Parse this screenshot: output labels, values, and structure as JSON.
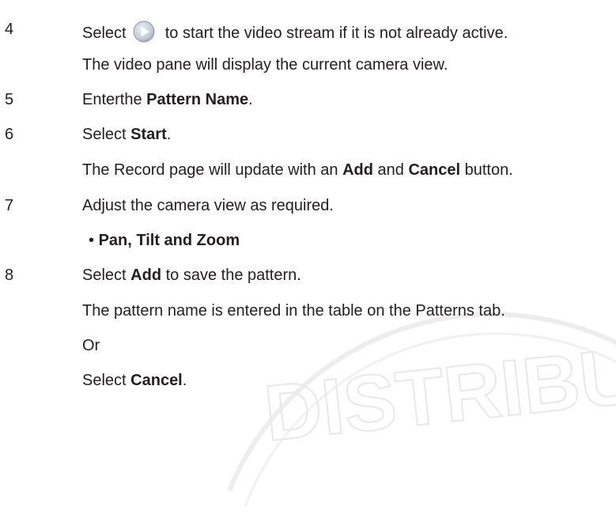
{
  "watermark_text": "DISTRIBUTOR",
  "steps": [
    {
      "number": "4",
      "line1_before": "Select",
      "line1_after": "to start the video stream if it is not already active.",
      "line2": "The video pane will display the current camera view."
    },
    {
      "number": "5",
      "line1_before": "Enterthe ",
      "line1_bold": "Pattern Name",
      "line1_after": "."
    },
    {
      "number": "6",
      "line1_before": "Select ",
      "line1_bold": "Start",
      "line1_after": ".",
      "line2_before": "The Record page will update with an ",
      "line2_bold1": "Add",
      "line2_mid": " and ",
      "line2_bold2": "Cancel",
      "line2_after": " button."
    },
    {
      "number": "7",
      "line1": "Adjust the camera view as required.",
      "bullet_symbol": "•",
      "bullet_text": "Pan, Tilt and Zoom"
    },
    {
      "number": "8",
      "line1_before": "Select ",
      "line1_bold": "Add",
      "line1_after": " to save the pattern.",
      "line2": "The pattern name is entered in the table on the Patterns tab.",
      "line3": "Or",
      "line4_before": "Select ",
      "line4_bold": "Cancel",
      "line4_after": "."
    }
  ],
  "icons": {
    "play": "play-button-icon"
  },
  "colors": {
    "text": "#231f20",
    "icon_blue": "#4d86c8",
    "watermark": "#ececec"
  }
}
